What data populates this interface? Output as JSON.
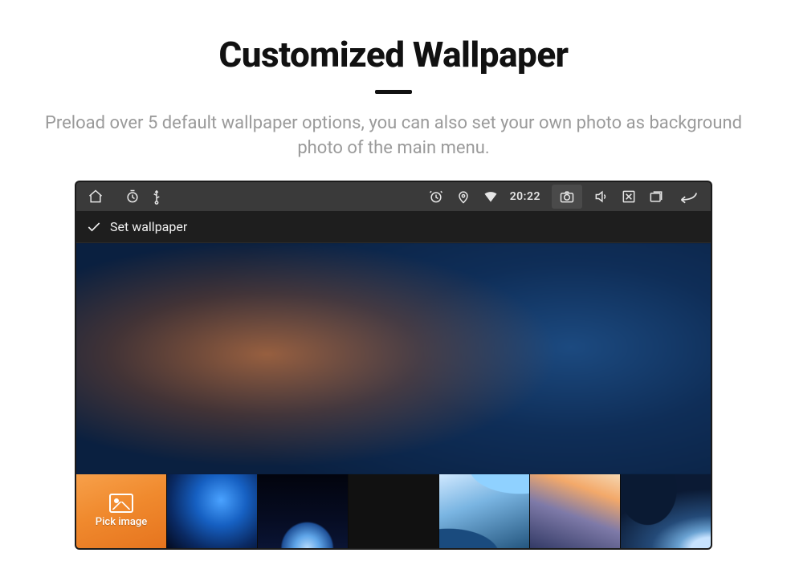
{
  "hero": {
    "title": "Customized Wallpaper",
    "subtitle": "Preload over 5 default wallpaper options, you can also set your own photo as background photo of the main menu."
  },
  "statusbar": {
    "time": "20:22",
    "icons": {
      "home": "home-icon",
      "timer": "timer-icon",
      "usb": "usb-icon",
      "alarm": "alarm-icon",
      "location": "location-icon",
      "wifi": "wifi-icon",
      "camera": "camera-icon",
      "volume": "volume-icon",
      "close": "x-box-icon",
      "recents": "recents-icon",
      "back": "back-icon"
    }
  },
  "titlebar": {
    "confirm_icon": "check-icon",
    "label": "Set wallpaper"
  },
  "thumbs": {
    "pick_label": "Pick image",
    "items": [
      {
        "id": "pick",
        "kind": "pick"
      },
      {
        "id": "nebula",
        "kind": "preset"
      },
      {
        "id": "planet",
        "kind": "preset"
      },
      {
        "id": "horizon",
        "kind": "preset"
      },
      {
        "id": "wave",
        "kind": "preset"
      },
      {
        "id": "aurora",
        "kind": "preset"
      },
      {
        "id": "swirl",
        "kind": "preset"
      }
    ]
  }
}
